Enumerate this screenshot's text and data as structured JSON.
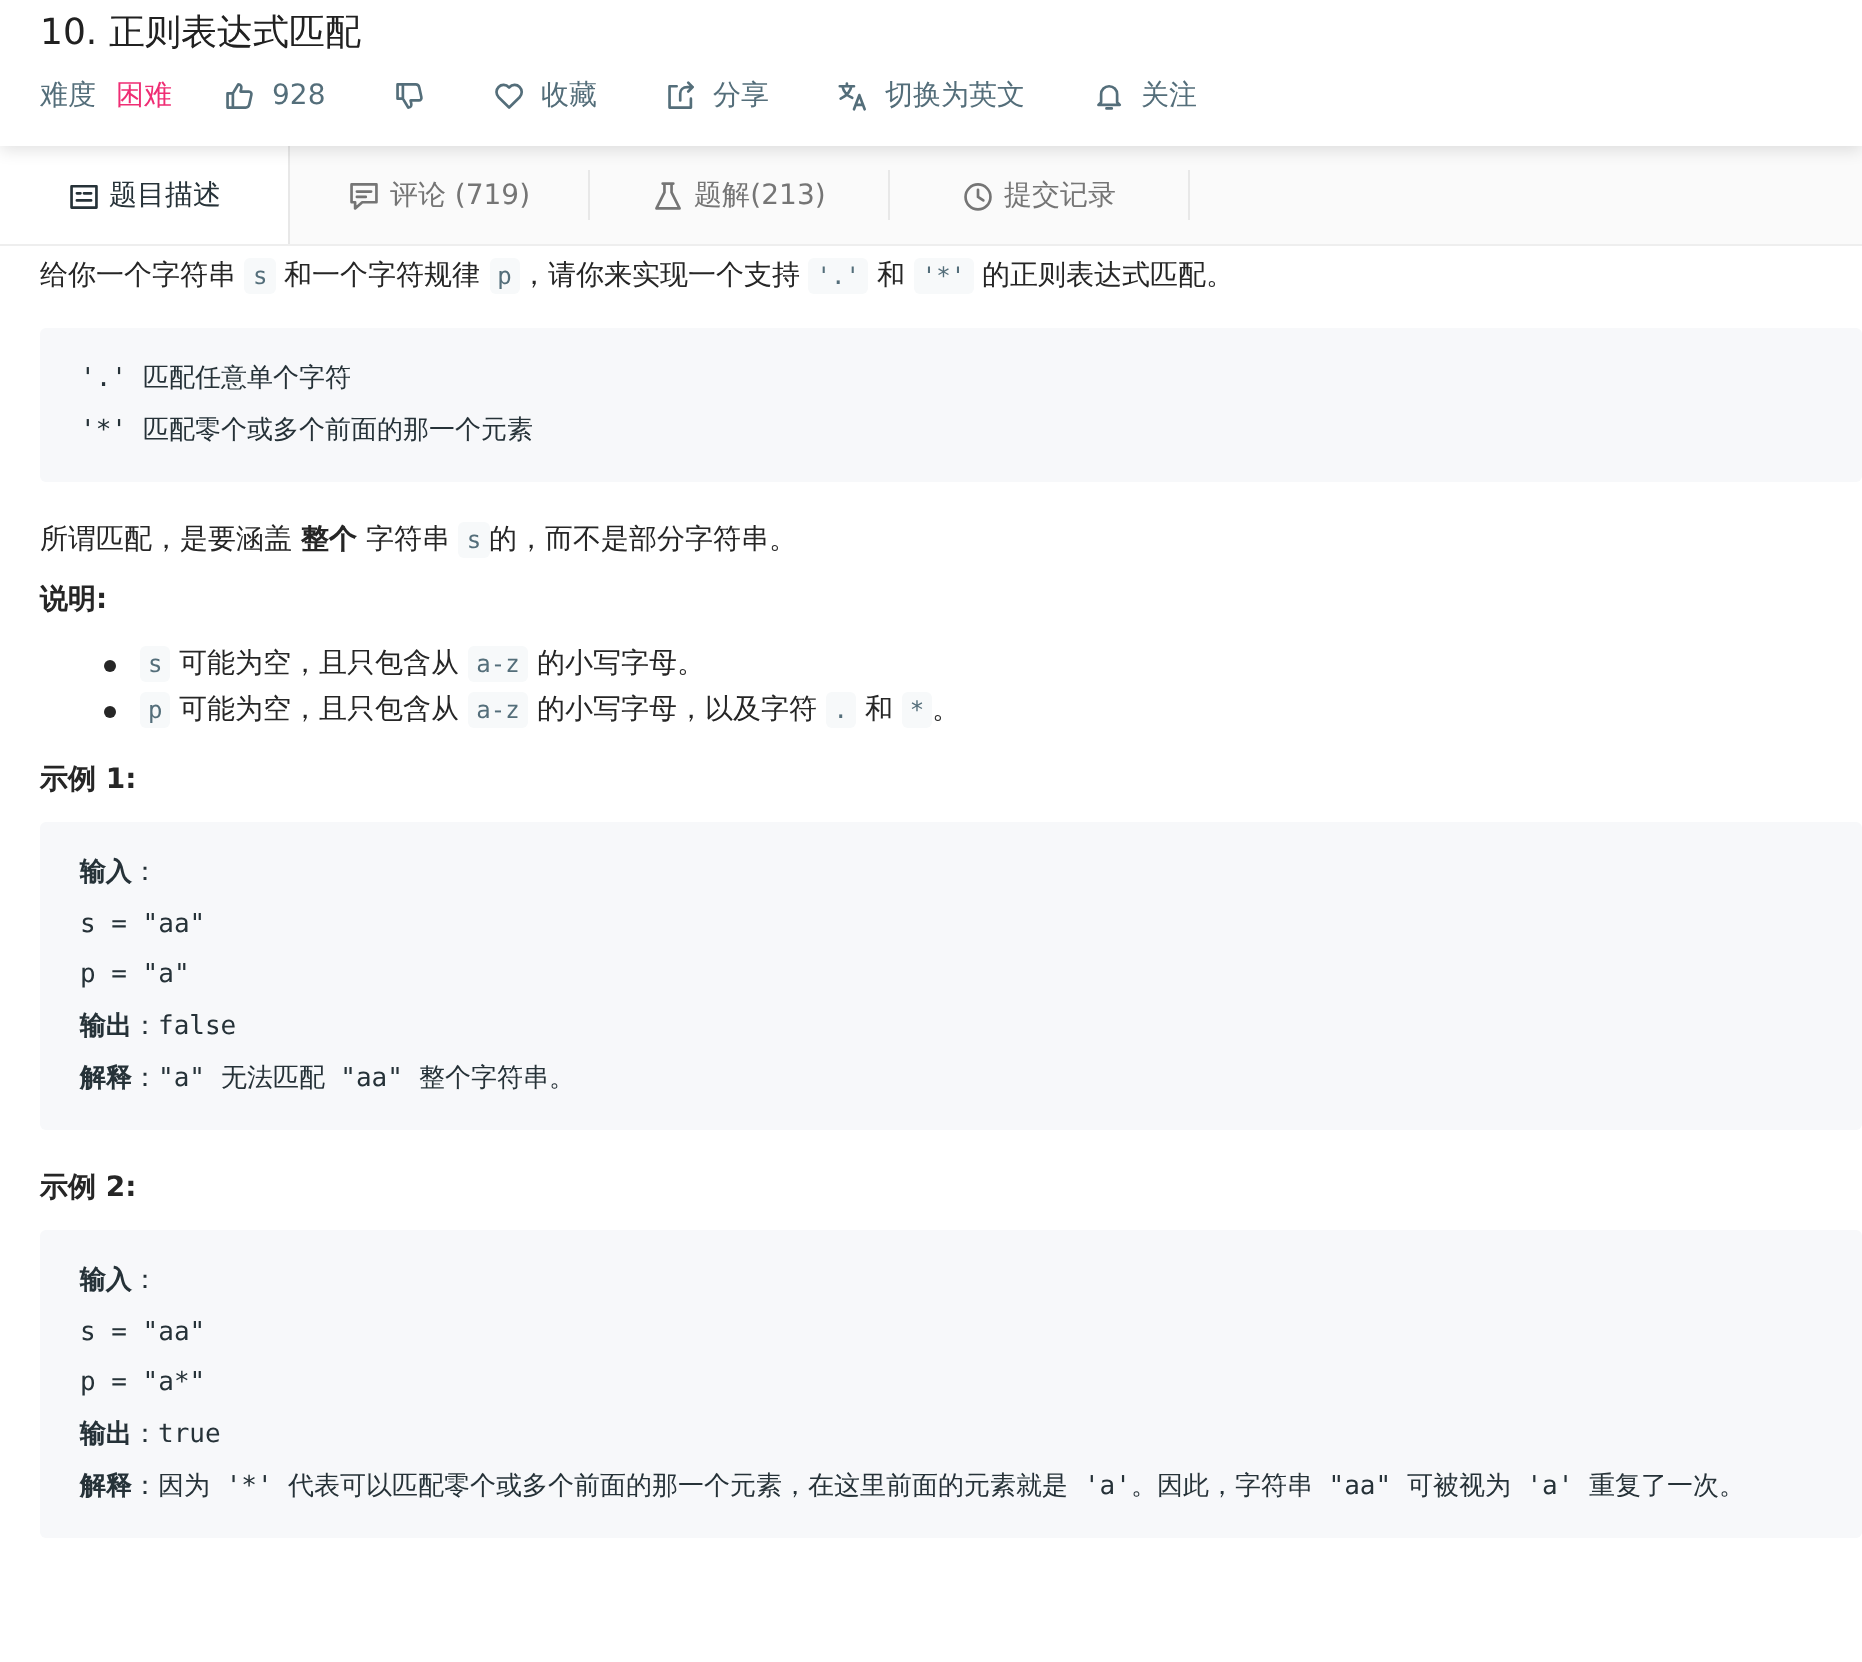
{
  "title": "10. 正则表达式匹配",
  "meta": {
    "difficulty_label": "难度",
    "difficulty": "困难"
  },
  "actions": [
    {
      "kind": "like",
      "label": "928"
    },
    {
      "kind": "dislike"
    },
    {
      "kind": "favorite",
      "label": "收藏"
    },
    {
      "kind": "share",
      "label": "分享"
    },
    {
      "kind": "language",
      "label": "切换为英文"
    },
    {
      "kind": "follow",
      "label": "关注"
    }
  ],
  "tabs": [
    {
      "kind": "description",
      "label": "题目描述",
      "selected": true
    },
    {
      "kind": "comments",
      "label": "评论 (719)",
      "selected": false
    },
    {
      "kind": "solutions",
      "label": "题解(213)",
      "selected": false
    },
    {
      "kind": "submissions",
      "label": "提交记录",
      "selected": false
    }
  ],
  "content": [
    {
      "kind": "paragraph",
      "segments": [
        {
          "kind": "text",
          "text": "给你一个字符串 "
        },
        {
          "kind": "code",
          "text": "s"
        },
        {
          "kind": "text",
          "text": " 和一个字符规律 "
        },
        {
          "kind": "code",
          "text": "p"
        },
        {
          "kind": "text",
          "text": "，请你来实现一个支持 "
        },
        {
          "kind": "code",
          "text": "'.'"
        },
        {
          "kind": "text",
          "text": " 和 "
        },
        {
          "kind": "code",
          "text": "'*'"
        },
        {
          "kind": "text",
          "text": " 的正则表达式匹配。"
        }
      ]
    },
    {
      "kind": "block",
      "lines": [
        [
          {
            "kind": "text",
            "text": "'.' 匹配任意单个字符"
          }
        ],
        [
          {
            "kind": "text",
            "text": "'*' 匹配零个或多个前面的那一个元素"
          }
        ]
      ]
    },
    {
      "kind": "paragraph",
      "segments": [
        {
          "kind": "text",
          "text": "所谓匹配，是要涵盖 "
        },
        {
          "kind": "bold",
          "text": "整个"
        },
        {
          "kind": "text",
          "text": " 字符串 "
        },
        {
          "kind": "code",
          "text": "s"
        },
        {
          "kind": "text",
          "text": "的，而不是部分字符串。"
        }
      ]
    },
    {
      "kind": "heading",
      "text": "说明:"
    },
    {
      "kind": "list",
      "items": [
        [
          {
            "kind": "code",
            "text": "s"
          },
          {
            "kind": "text",
            "text": " 可能为空，且只包含从 "
          },
          {
            "kind": "code",
            "text": "a-z"
          },
          {
            "kind": "text",
            "text": " 的小写字母。"
          }
        ],
        [
          {
            "kind": "code",
            "text": "p"
          },
          {
            "kind": "text",
            "text": " 可能为空，且只包含从 "
          },
          {
            "kind": "code",
            "text": "a-z"
          },
          {
            "kind": "text",
            "text": " 的小写字母，以及字符 "
          },
          {
            "kind": "code",
            "text": "."
          },
          {
            "kind": "text",
            "text": " 和 "
          },
          {
            "kind": "code",
            "text": "*"
          },
          {
            "kind": "text",
            "text": "。"
          }
        ]
      ]
    },
    {
      "kind": "heading",
      "text": "示例 1:"
    },
    {
      "kind": "block",
      "lines": [
        [
          {
            "kind": "bold",
            "text": "输入"
          },
          {
            "kind": "text",
            "text": "："
          }
        ],
        [
          {
            "kind": "text",
            "text": "s = \"aa\""
          }
        ],
        [
          {
            "kind": "text",
            "text": "p = \"a\""
          }
        ],
        [
          {
            "kind": "bold",
            "text": "输出"
          },
          {
            "kind": "text",
            "text": "：false"
          }
        ],
        [
          {
            "kind": "bold",
            "text": "解释"
          },
          {
            "kind": "text",
            "text": "：\"a\" 无法匹配 \"aa\" 整个字符串。"
          }
        ]
      ]
    },
    {
      "kind": "heading",
      "text": "示例 2:"
    },
    {
      "kind": "block",
      "lines": [
        [
          {
            "kind": "bold",
            "text": "输入"
          },
          {
            "kind": "text",
            "text": "："
          }
        ],
        [
          {
            "kind": "text",
            "text": "s = \"aa\""
          }
        ],
        [
          {
            "kind": "text",
            "text": "p = \"a*\""
          }
        ],
        [
          {
            "kind": "bold",
            "text": "输出"
          },
          {
            "kind": "text",
            "text": "：true"
          }
        ],
        [
          {
            "kind": "bold",
            "text": "解释"
          },
          {
            "kind": "text",
            "text": "：因为 '*' 代表可以匹配零个或多个前面的那一个元素，在这里前面的元素就是 'a'。因此，字符串 \"aa\" 可被视为 'a' 重复了一次。"
          }
        ]
      ]
    }
  ]
}
